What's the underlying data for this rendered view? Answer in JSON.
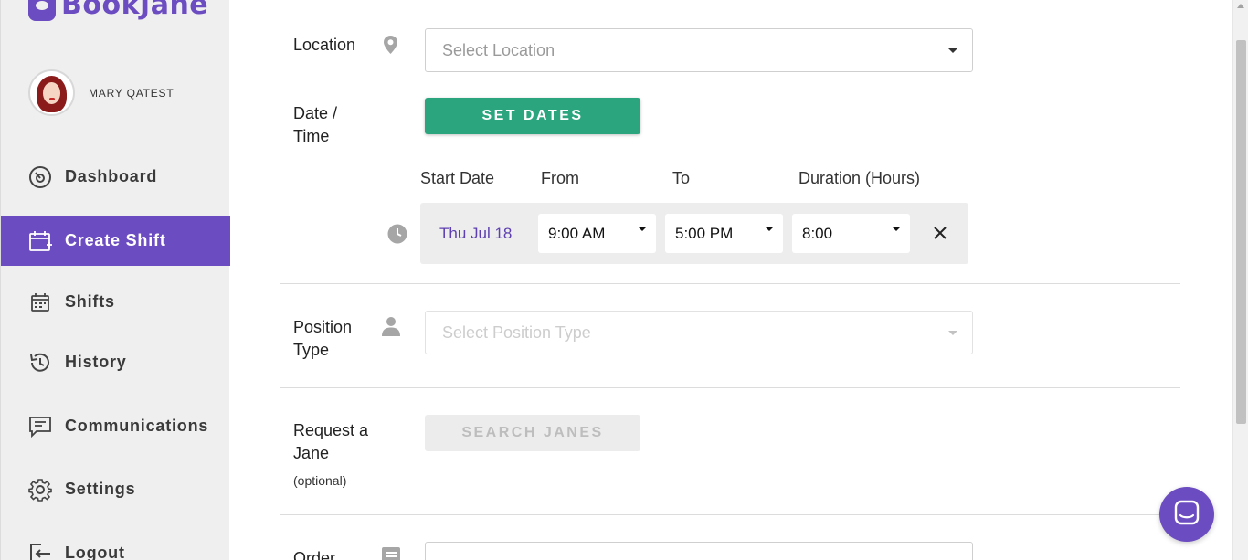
{
  "brand": {
    "name": "BookJane",
    "accent": "#6c4cc1",
    "green": "#2ba57e"
  },
  "user": {
    "name": "MARY QATEST"
  },
  "sidebar": {
    "items": [
      {
        "label": "Dashboard",
        "icon": "dashboard-icon"
      },
      {
        "label": "Create Shift",
        "icon": "calendar-plus-icon",
        "active": true
      },
      {
        "label": "Shifts",
        "icon": "calendar-icon"
      },
      {
        "label": "History",
        "icon": "history-icon"
      },
      {
        "label": "Communications",
        "icon": "chat-icon"
      },
      {
        "label": "Settings",
        "icon": "gear-icon"
      },
      {
        "label": "Logout",
        "icon": "logout-icon"
      }
    ]
  },
  "form": {
    "location": {
      "label": "Location",
      "placeholder": "Select Location"
    },
    "datetime": {
      "label_line1": "Date /",
      "label_line2": "Time",
      "set_dates_button": "SET DATES",
      "columns": {
        "start_date": "Start Date",
        "from": "From",
        "to": "To",
        "duration": "Duration (Hours)"
      },
      "shift": {
        "date": "Thu Jul 18",
        "from": "9:00 AM",
        "to": "5:00 PM",
        "duration": "8:00"
      }
    },
    "position": {
      "label_line1": "Position",
      "label_line2": "Type",
      "placeholder": "Select Position Type"
    },
    "request": {
      "label_line1": "Request a",
      "label_line2": "Jane",
      "optional": "(optional)",
      "button": "SEARCH JANES"
    },
    "order": {
      "label": "Order"
    }
  }
}
